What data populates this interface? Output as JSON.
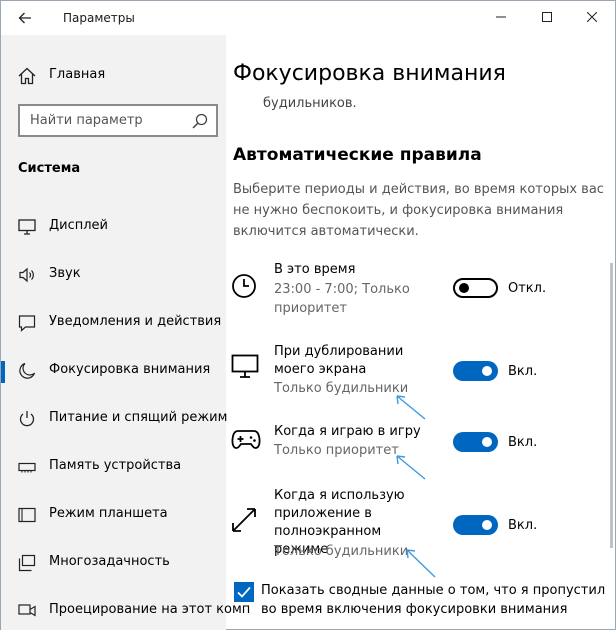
{
  "window": {
    "title": "Параметры"
  },
  "sidebar": {
    "home_label": "Главная",
    "search_placeholder": "Найти параметр",
    "section_label": "Система",
    "items": [
      {
        "label": "Дисплей",
        "icon": "monitor-icon"
      },
      {
        "label": "Звук",
        "icon": "speaker-icon"
      },
      {
        "label": "Уведомления и действия",
        "icon": "notification-icon"
      },
      {
        "label": "Фокусировка внимания",
        "icon": "moon-icon",
        "active": true
      },
      {
        "label": "Питание и спящий режим",
        "icon": "power-icon"
      },
      {
        "label": "Память устройства",
        "icon": "storage-icon"
      },
      {
        "label": "Режим планшета",
        "icon": "tablet-icon"
      },
      {
        "label": "Многозадачность",
        "icon": "multitasking-icon"
      },
      {
        "label": "Проецирование на этот комп",
        "icon": "projection-icon"
      }
    ]
  },
  "main": {
    "title": "Фокусировка внимания",
    "fragment_text": "будильников.",
    "rules_title": "Автоматические правила",
    "rules_description": "Выберите периоды и действия, во время которых вас не нужно беспокоить, и фокусировка внимания включится автоматически.",
    "rules": [
      {
        "name": "В это время",
        "sub": "23:00 - 7:00; Только приоритет",
        "state": "Откл.",
        "on": false,
        "icon": "clock-icon"
      },
      {
        "name": "При дублировании моего экрана",
        "sub": "Только будильники",
        "state": "Вкл.",
        "on": true,
        "icon": "monitor-icon"
      },
      {
        "name": "Когда я играю в игру",
        "sub": "Только приоритет",
        "state": "Вкл.",
        "on": true,
        "icon": "gamepad-icon"
      },
      {
        "name": "Когда я использую приложение в полноэкранном режиме",
        "sub": "Только будильники",
        "state": "Вкл.",
        "on": true,
        "icon": "fullscreen-icon"
      }
    ],
    "summary_checkbox": {
      "label": "Показать сводные данные о том, что я пропустил во время включения фокусировки внимания",
      "checked": true
    }
  },
  "colors": {
    "accent": "#0067c0",
    "annotation_arrow": "#3d9be0",
    "sidebar_bg": "#f2f2f2"
  }
}
